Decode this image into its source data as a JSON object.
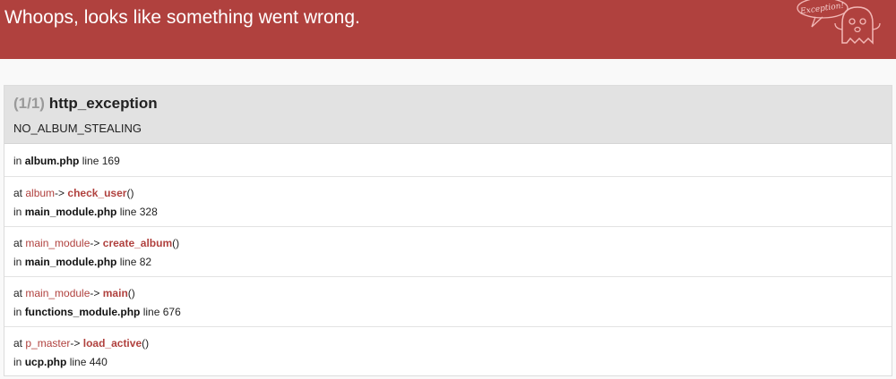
{
  "header": {
    "title": "Whoops, looks like something went wrong.",
    "logo_text": "Exception!",
    "bg_color": "#b0413e"
  },
  "exception": {
    "counter": "(1/1)",
    "class": "http_exception",
    "message": "NO_ALBUM_STEALING"
  },
  "trace": {
    "origin": {
      "in": "in",
      "file": "album.php",
      "line_label": "line",
      "line": "169"
    },
    "frames": [
      {
        "at": "at",
        "class": "album",
        "arrow": "->",
        "func": "check_user",
        "args": "()",
        "in": "in",
        "file": "main_module.php",
        "line_label": "line",
        "line": "328"
      },
      {
        "at": "at",
        "class": "main_module",
        "arrow": "->",
        "func": "create_album",
        "args": "()",
        "in": "in",
        "file": "main_module.php",
        "line_label": "line",
        "line": "82"
      },
      {
        "at": "at",
        "class": "main_module",
        "arrow": "->",
        "func": "main",
        "args": "()",
        "in": "in",
        "file": "functions_module.php",
        "line_label": "line",
        "line": "676"
      },
      {
        "at": "at",
        "class": "p_master",
        "arrow": "->",
        "func": "load_active",
        "args": "()",
        "in": "in",
        "file": "ucp.php",
        "line_label": "line",
        "line": "440"
      }
    ]
  }
}
